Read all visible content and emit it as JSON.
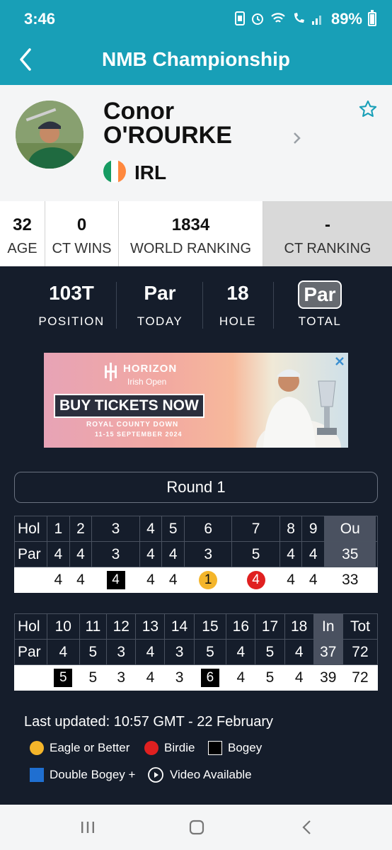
{
  "status": {
    "time": "3:46",
    "battery": "89%"
  },
  "header": {
    "title": "NMB Championship"
  },
  "player": {
    "first_name": "Conor",
    "last_name": "O'ROURKE",
    "country": "IRL"
  },
  "stats": [
    {
      "value": "32",
      "label": "AGE"
    },
    {
      "value": "0",
      "label": "CT WINS"
    },
    {
      "value": "1834",
      "label": "WORLD RANKING"
    },
    {
      "value": "-",
      "label": "CT RANKING"
    }
  ],
  "position": [
    {
      "value": "103T",
      "label": "POSITION"
    },
    {
      "value": "Par",
      "label": "TODAY"
    },
    {
      "value": "18",
      "label": "HOLE"
    },
    {
      "value": "Par",
      "label": "TOTAL"
    }
  ],
  "ad": {
    "brand": "HORIZON",
    "subtitle": "Irish Open",
    "cta": "BUY TICKETS NOW",
    "venue": "ROYAL COUNTY DOWN",
    "dates": "11-15 SEPTEMBER 2024"
  },
  "round": "Round 1",
  "front": {
    "hole_label": "Hol",
    "par_label": "Par",
    "holes": [
      "1",
      "2",
      "3",
      "4",
      "5",
      "6",
      "7",
      "8",
      "9"
    ],
    "total_label": "Ou",
    "pars": [
      "4",
      "4",
      "3",
      "4",
      "4",
      "3",
      "5",
      "4",
      "4"
    ],
    "par_total": "35",
    "scores": [
      "4",
      "4",
      "4",
      "4",
      "4",
      "1",
      "4",
      "4",
      "4"
    ],
    "score_total": "33"
  },
  "back": {
    "hole_label": "Hol",
    "par_label": "Par",
    "holes": [
      "10",
      "11",
      "12",
      "13",
      "14",
      "15",
      "16",
      "17",
      "18"
    ],
    "in_label": "In",
    "tot_label": "Tot",
    "pars": [
      "4",
      "5",
      "3",
      "4",
      "3",
      "5",
      "4",
      "5",
      "4"
    ],
    "par_in": "37",
    "par_tot": "72",
    "scores": [
      "5",
      "5",
      "3",
      "4",
      "3",
      "6",
      "4",
      "5",
      "4"
    ],
    "score_in": "39",
    "score_tot": "72"
  },
  "updated": "Last updated: 10:57 GMT - 22 February",
  "legend": {
    "eagle": "Eagle or Better",
    "birdie": "Birdie",
    "bogey": "Bogey",
    "double": "Double Bogey +",
    "video": "Video Available"
  },
  "colors": {
    "brand": "#189fb7",
    "dark_bg": "#151d2b",
    "eagle": "#f4b52a",
    "birdie": "#e02020",
    "bogey": "#000000",
    "double_bogey": "#1f6fd1"
  }
}
